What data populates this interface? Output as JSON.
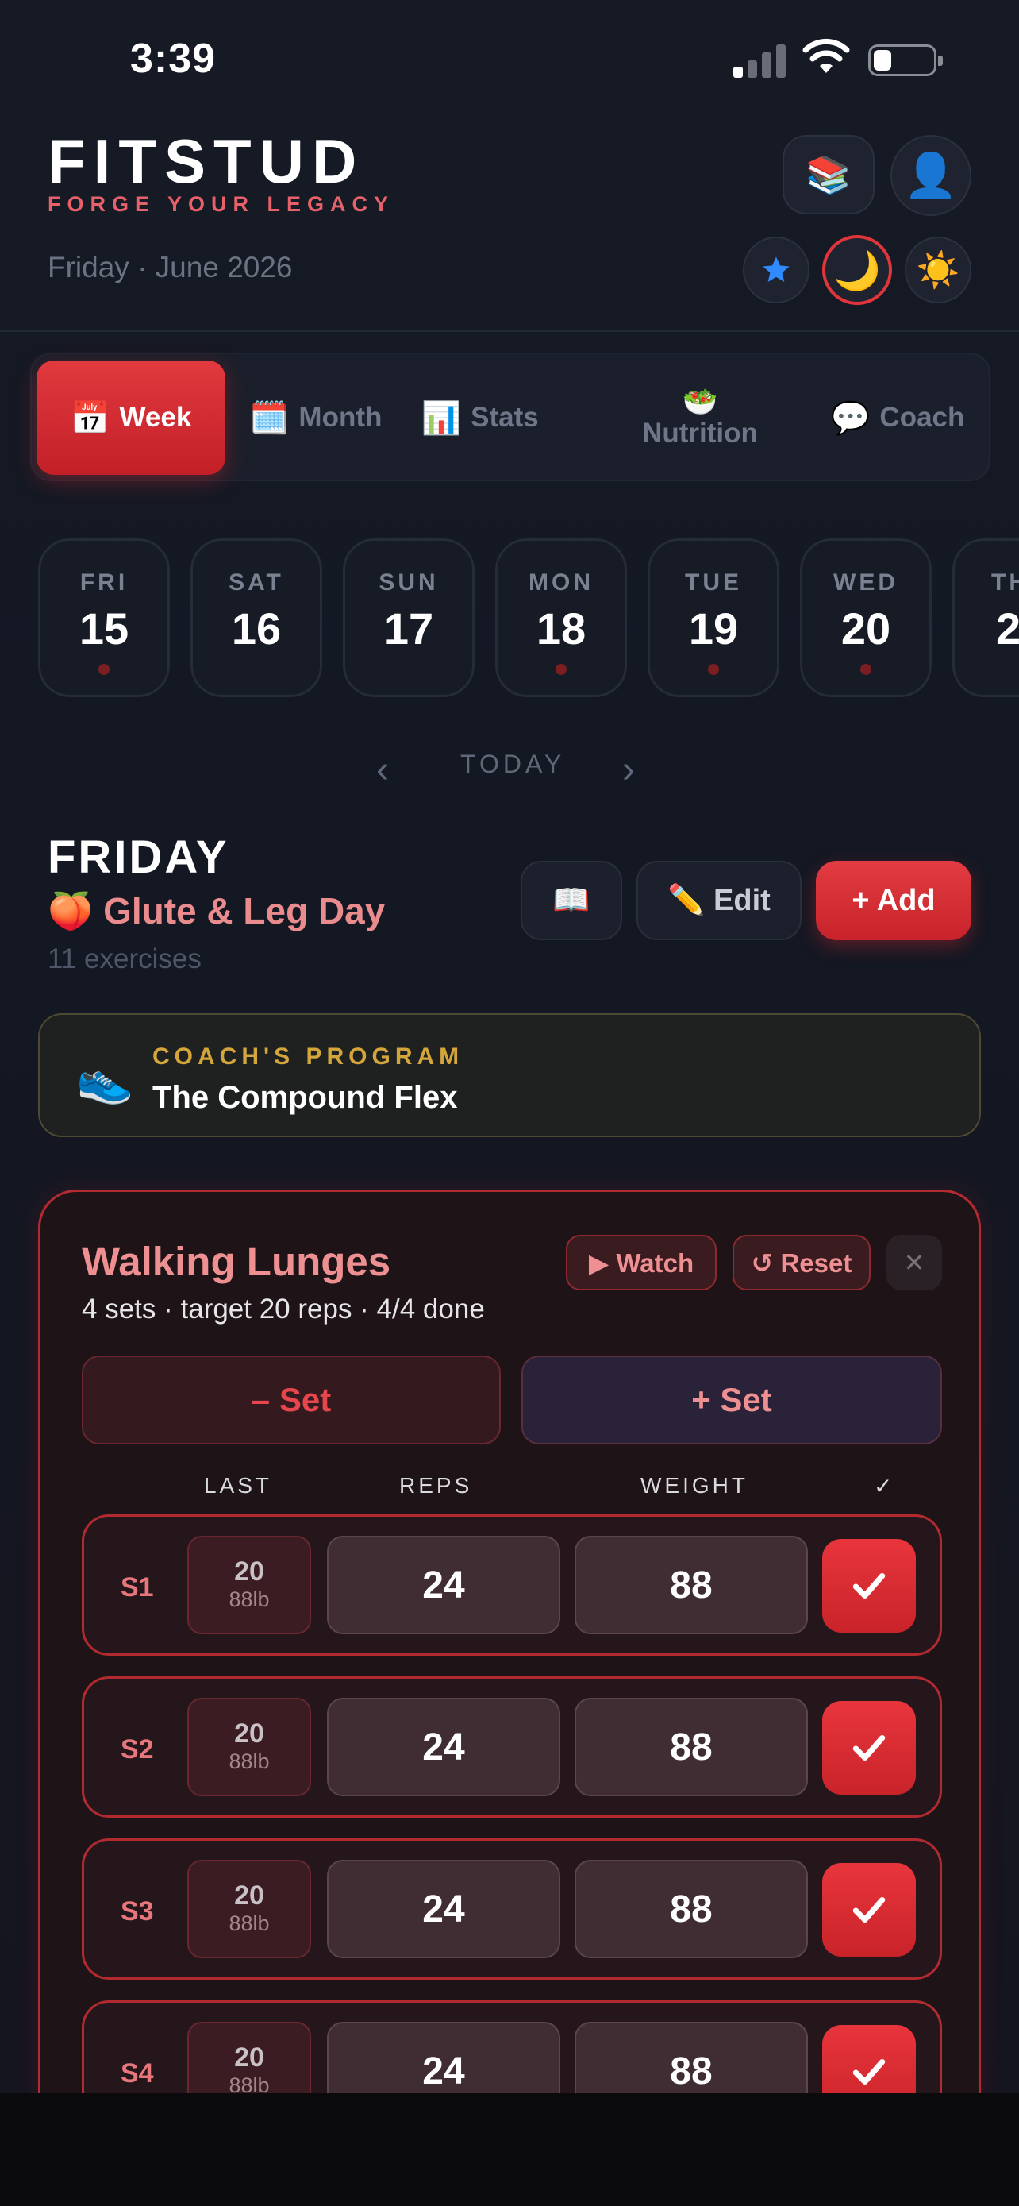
{
  "status_bar": {
    "time": "3:39"
  },
  "header": {
    "brand": "FITSTUD",
    "tagline": "FORGE YOUR LEGACY",
    "date_line": "Friday · June 2026",
    "icons": [
      "books-icon",
      "profile-icon",
      "star-icon",
      "moon-icon",
      "sun-icon"
    ]
  },
  "tabs": [
    {
      "emoji": "📅",
      "label": "Week",
      "active": true
    },
    {
      "emoji": "🗓️",
      "label": "Month",
      "active": false
    },
    {
      "emoji": "📊",
      "label": "Stats",
      "active": false
    },
    {
      "emoji": "🥗",
      "label": "Nutrition",
      "active": false
    },
    {
      "emoji": "💬",
      "label": "Coach",
      "active": false
    }
  ],
  "days": [
    {
      "name": "FRI",
      "num": "15"
    },
    {
      "name": "SAT",
      "num": "16"
    },
    {
      "name": "SUN",
      "num": "17"
    },
    {
      "name": "MON",
      "num": "18"
    },
    {
      "name": "TUE",
      "num": "19"
    },
    {
      "name": "WED",
      "num": "20"
    },
    {
      "name": "TH",
      "num": "2"
    }
  ],
  "day_nav": {
    "prev": "‹",
    "label": "TODAY",
    "next": "›"
  },
  "day_header": {
    "title": "FRIDAY",
    "workout_emoji": "🍑",
    "workout_name": "Glute & Leg Day",
    "exercise_count": "11 exercises",
    "book_icon": "📖",
    "edit_label": "✏️ Edit",
    "add_label": "+ Add"
  },
  "coach_program": {
    "icon": "👟",
    "kicker": "COACH'S PROGRAM",
    "name": "The Compound Flex"
  },
  "exercise": {
    "name": "Walking Lunges",
    "subtitle": "4 sets · target 20 reps · 4/4 done",
    "watch_label": "▶ Watch",
    "reset_label": "↺ Reset",
    "close_label": "✕",
    "minus_set_label": "– Set",
    "plus_set_label": "+ Set",
    "columns": {
      "last": "LAST",
      "reps": "REPS",
      "weight": "WEIGHT",
      "done": "✓"
    },
    "sets": [
      {
        "label": "S1",
        "last_reps": "20",
        "last_weight": "88lb",
        "reps": "24",
        "weight": "88",
        "done": true
      },
      {
        "label": "S2",
        "last_reps": "20",
        "last_weight": "88lb",
        "reps": "24",
        "weight": "88",
        "done": true
      },
      {
        "label": "S3",
        "last_reps": "20",
        "last_weight": "88lb",
        "reps": "24",
        "weight": "88",
        "done": true
      },
      {
        "label": "S4",
        "last_reps": "20",
        "last_weight": "88lb",
        "reps": "24",
        "weight": "88",
        "done": true
      }
    ]
  },
  "colors": {
    "accent": "#d92d33",
    "accent_soft": "#ee8f92",
    "background": "#141823",
    "gold": "#d3a53b"
  }
}
